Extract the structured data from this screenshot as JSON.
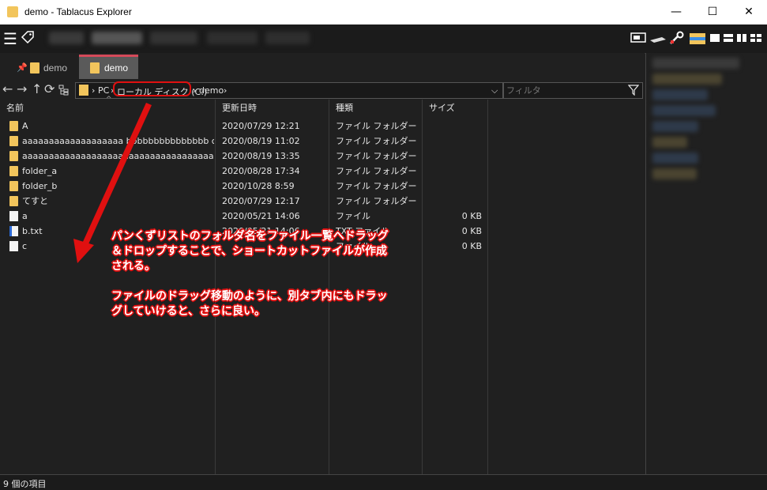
{
  "window": {
    "title": "demo - Tablacus Explorer",
    "minimize": "—",
    "maximize": "☐",
    "close": "✕"
  },
  "tabs": [
    {
      "label": "demo",
      "pinned": true
    },
    {
      "label": "demo",
      "active": true
    }
  ],
  "address": {
    "crumbs": [
      "PC",
      "ローカル ディスク (C:)",
      "demo"
    ],
    "separator": "›",
    "filter_placeholder": "フィルタ"
  },
  "columns": {
    "name": "名前",
    "date": "更新日時",
    "type": "種類",
    "size": "サイズ"
  },
  "files": [
    {
      "name": "A",
      "date": "2020/07/29 12:21",
      "type": "ファイル フォルダー",
      "size": "",
      "icon": "folder-icon"
    },
    {
      "name": "aaaaaaaaaaaaaaaaaaa bbbbbbbbbbbbbbb c...",
      "date": "2020/08/19 11:02",
      "type": "ファイル フォルダー",
      "size": "",
      "icon": "folder-icon"
    },
    {
      "name": "aaaaaaaaaaaaaaaaaaaaaaaaaaaaaaaaaaaaaabb...",
      "date": "2020/08/19 13:35",
      "type": "ファイル フォルダー",
      "size": "",
      "icon": "folder-icon"
    },
    {
      "name": "folder_a",
      "date": "2020/08/28 17:34",
      "type": "ファイル フォルダー",
      "size": "",
      "icon": "folder-icon"
    },
    {
      "name": "folder_b",
      "date": "2020/10/28 8:59",
      "type": "ファイル フォルダー",
      "size": "",
      "icon": "folder-icon"
    },
    {
      "name": "てすと",
      "date": "2020/07/29 12:17",
      "type": "ファイル フォルダー",
      "size": "",
      "icon": "folder-icon"
    },
    {
      "name": "a",
      "date": "2020/05/21 14:06",
      "type": "ファイル",
      "size": "0 KB",
      "icon": "file-icon"
    },
    {
      "name": "b.txt",
      "date": "2020/05/21 14:06",
      "type": "TXT ファイル",
      "size": "0 KB",
      "icon": "text-file-icon"
    },
    {
      "name": "c",
      "date": "",
      "type": "ファイル",
      "size": "0 KB",
      "icon": "file-icon"
    }
  ],
  "status": {
    "text": "9 個の項目"
  },
  "annotation": {
    "line1": "パンくずリストのフォルダ名をファイル一覧へドラッグ＆ドロップすることで、ショートカットファイルが作成される。",
    "line2": "ファイルのドラッグ移動のように、別タブ内にもドラッグしていけると、さらに良い。",
    "color": "#e01010"
  },
  "colors": {
    "folder": "#f2c55c",
    "accent_tab": "#d64a5a",
    "background": "#202020"
  }
}
